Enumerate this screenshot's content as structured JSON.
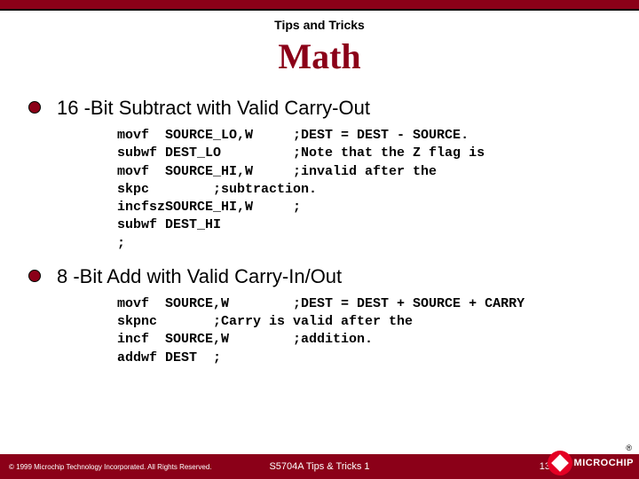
{
  "header": {
    "kicker": "Tips and Tricks",
    "title": "Math"
  },
  "bullets": [
    {
      "text": "16 -Bit Subtract with Valid Carry-Out",
      "code": "movf  SOURCE_LO,W     ;DEST = DEST - SOURCE.\nsubwf DEST_LO         ;Note that the Z flag is\nmovf  SOURCE_HI,W     ;invalid after the\nskpc        ;subtraction.\nincfszSOURCE_HI,W     ;\nsubwf DEST_HI\n;"
    },
    {
      "text": "8 -Bit Add with Valid Carry-In/Out",
      "code": "movf  SOURCE,W        ;DEST = DEST + SOURCE + CARRY\nskpnc       ;Carry is valid after the\nincf  SOURCE,W        ;addition.\naddwf DEST  ;"
    }
  ],
  "footer": {
    "copyright": "© 1999 Microchip Technology Incorporated. All Rights Reserved.",
    "center": "S5704A Tips & Tricks 1",
    "page": "13",
    "logo_reg": "®",
    "logo_text": "MICROCHIP"
  }
}
